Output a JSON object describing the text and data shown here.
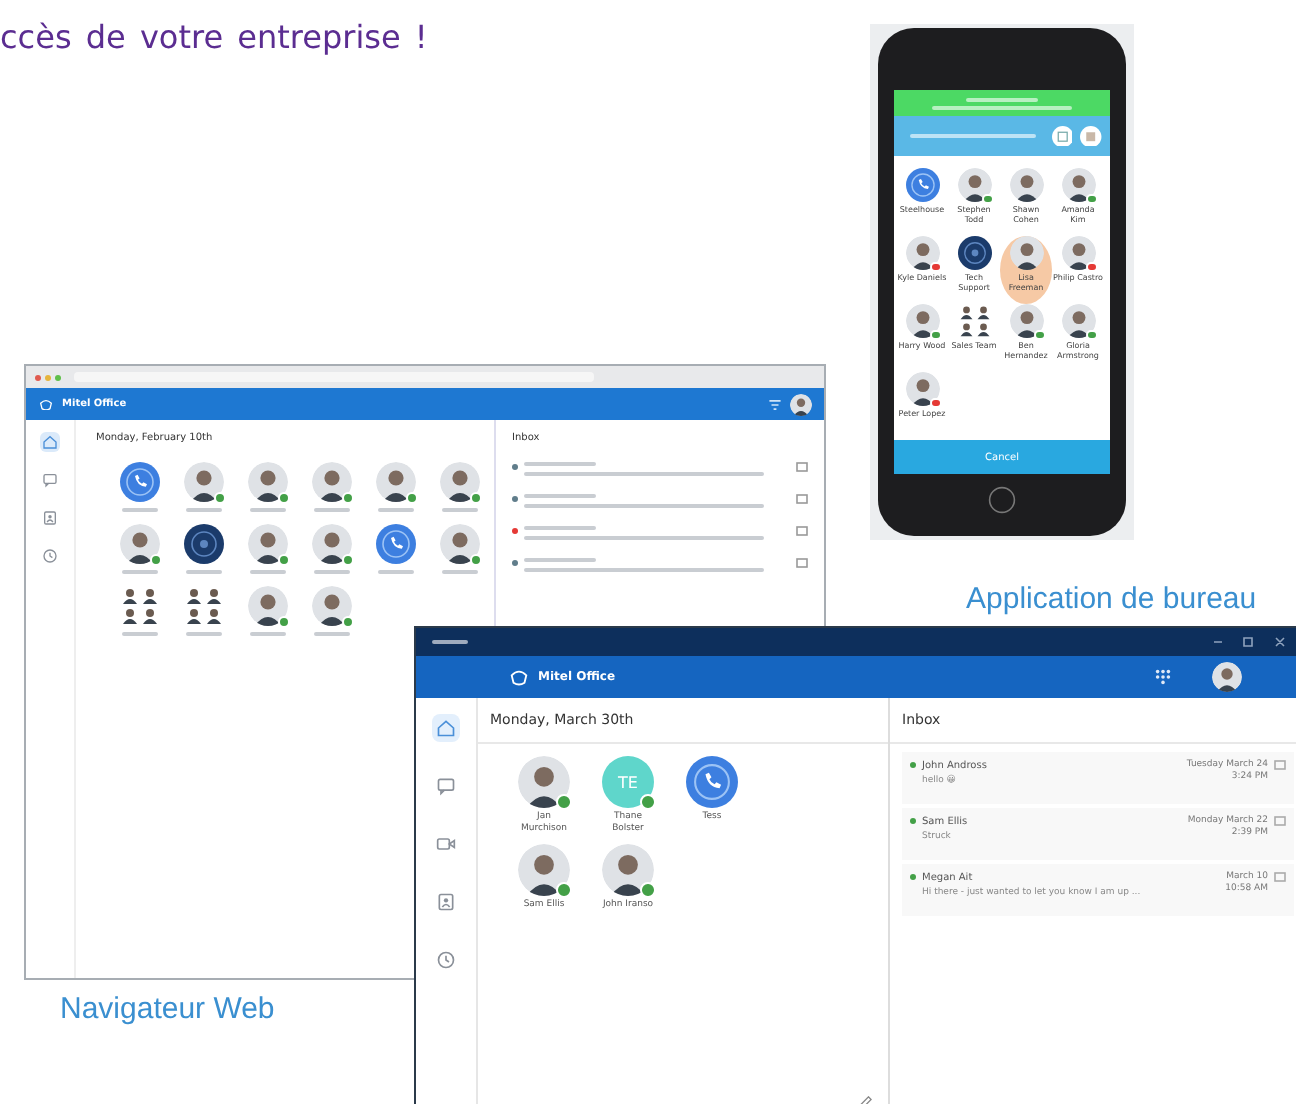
{
  "heading": "ccès de votre entreprise !",
  "web": {
    "brand": "Mitel Office",
    "date": "Monday, February 10th",
    "inbox_title": "Inbox",
    "nav": [
      {
        "kind": "home",
        "selected": true
      },
      {
        "kind": "chat",
        "selected": false
      },
      {
        "kind": "contacts",
        "selected": false
      },
      {
        "kind": "history",
        "selected": false
      }
    ],
    "contacts": [
      {
        "kind": "phone"
      },
      {
        "kind": "person",
        "color": "#43a047"
      },
      {
        "kind": "person",
        "color": "#43a047"
      },
      {
        "kind": "person",
        "color": "#43a047"
      },
      {
        "kind": "person",
        "color": "#43a047"
      },
      {
        "kind": "person",
        "color": "#43a047"
      },
      {
        "kind": "person",
        "color": "#43a047"
      },
      {
        "kind": "team"
      },
      {
        "kind": "person",
        "color": "#43a047"
      },
      {
        "kind": "person",
        "color": "#43a047"
      },
      {
        "kind": "phone"
      },
      {
        "kind": "person",
        "color": "#43a047"
      },
      {
        "kind": "group"
      },
      {
        "kind": "group"
      },
      {
        "kind": "person",
        "color": "#43a047"
      },
      {
        "kind": "person",
        "color": "#43a047"
      }
    ],
    "inbox": [
      {
        "color": "#607d8b"
      },
      {
        "color": "#607d8b"
      },
      {
        "color": "#e53935"
      },
      {
        "color": "#607d8b"
      }
    ]
  },
  "desktop": {
    "brand": "Mitel Office",
    "date": "Monday, March 30th",
    "inbox_title": "Inbox",
    "nav": [
      {
        "kind": "home",
        "selected": true
      },
      {
        "kind": "chat",
        "selected": false
      },
      {
        "kind": "video",
        "selected": false
      },
      {
        "kind": "contacts",
        "selected": false
      },
      {
        "kind": "history",
        "selected": false
      }
    ],
    "contacts": [
      {
        "kind": "person",
        "name": "Jan Murchison",
        "color": "#43a047"
      },
      {
        "kind": "initials",
        "initials": "TE",
        "name": "Thane Bolster",
        "color": "#43a047"
      },
      {
        "kind": "phone",
        "name": "Tess"
      },
      {
        "kind": "person",
        "name": "Sam Ellis",
        "color": "#43a047"
      },
      {
        "kind": "person",
        "name": "John Iranso",
        "color": "#43a047"
      }
    ],
    "inbox": [
      {
        "name": "John Andross",
        "preview": "hello 😀",
        "date": "Tuesday March 24",
        "time": "3:24 PM",
        "color": "#43a047"
      },
      {
        "name": "Sam Ellis",
        "preview": "Struck",
        "date": "Monday March 22",
        "time": "2:39 PM",
        "color": "#43a047"
      },
      {
        "name": "Megan Ait",
        "preview": "Hi there - just wanted to let you know I am up ...",
        "date": "March 10",
        "time": "10:58 AM",
        "color": "#43a047"
      }
    ]
  },
  "desktop_caption": "Application de bureau",
  "web_caption": "Navigateur Web",
  "phone": {
    "contacts": [
      {
        "kind": "phone",
        "name": "Steelhouse",
        "selected": false
      },
      {
        "kind": "person",
        "name": "Stephen Todd",
        "color": "#43a047",
        "selected": false
      },
      {
        "kind": "person",
        "name": "Shawn Cohen",
        "selected": false
      },
      {
        "kind": "person",
        "name": "Amanda Kim",
        "color": "#43a047",
        "selected": false
      },
      {
        "kind": "person",
        "name": "Kyle Daniels",
        "color": "#e53935",
        "selected": false
      },
      {
        "kind": "team",
        "name": "Tech Support",
        "selected": false
      },
      {
        "kind": "person",
        "name": "Lisa Freeman",
        "selected": true
      },
      {
        "kind": "person",
        "name": "Philip Castro",
        "color": "#e53935",
        "selected": false
      },
      {
        "kind": "person",
        "name": "Harry Wood",
        "color": "#43a047",
        "selected": false
      },
      {
        "kind": "group",
        "name": "Sales Team",
        "selected": false
      },
      {
        "kind": "person",
        "name": "Ben Hernandez",
        "color": "#43a047",
        "selected": false
      },
      {
        "kind": "person",
        "name": "Gloria Armstrong",
        "color": "#43a047",
        "selected": false
      },
      {
        "kind": "person",
        "name": "Peter Lopez",
        "color": "#e53935",
        "selected": false
      }
    ],
    "button": "Cancel"
  }
}
